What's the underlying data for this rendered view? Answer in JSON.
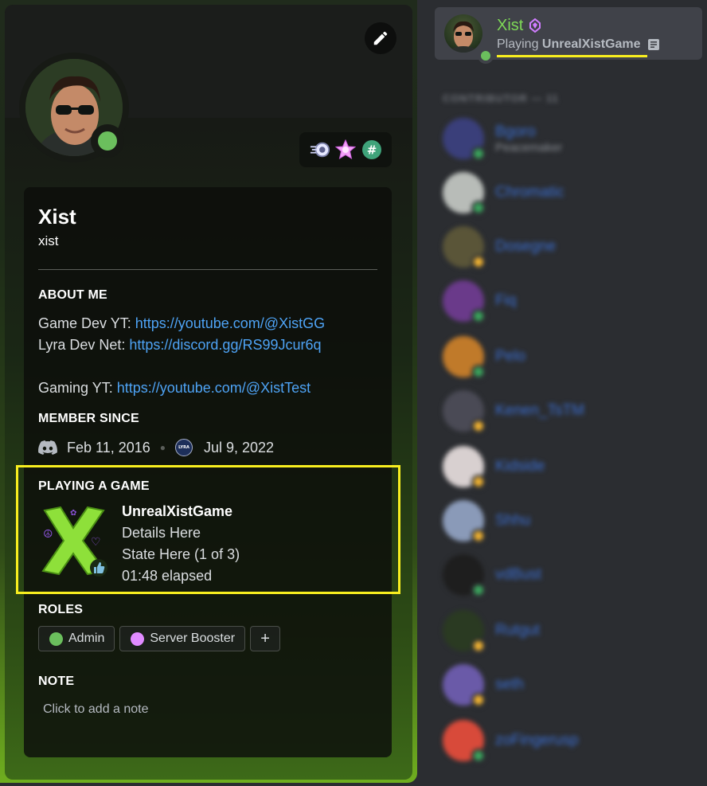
{
  "profile": {
    "display_name": "Xist",
    "username": "xist",
    "about_title": "ABOUT ME",
    "about_lines": {
      "game_dev_prefix": "Game Dev YT: ",
      "game_dev_link": "https://youtube.com/@XistGG",
      "lyra_prefix": "Lyra Dev Net: ",
      "lyra_link": "https://discord.gg/RS99Jcur6q",
      "gaming_prefix": "Gaming YT: ",
      "gaming_link": "https://youtube.com/@XistTest"
    },
    "member_since_title": "MEMBER SINCE",
    "discord_since": "Feb 11, 2016",
    "server_since": "Jul 9, 2022",
    "server_icon_label": "LYRA",
    "playing_title": "PLAYING A GAME",
    "game": {
      "name": "UnrealXistGame",
      "details": "Details Here",
      "state": "State Here (1 of 3)",
      "elapsed": "01:48 elapsed"
    },
    "roles_title": "ROLES",
    "roles": [
      {
        "label": "Admin",
        "color": "#6bbf5d"
      },
      {
        "label": "Server Booster",
        "color": "#e08bff"
      }
    ],
    "add_role_label": "+",
    "note_title": "NOTE",
    "note_placeholder": "Click to add a note",
    "status_color": "#6bbf5d"
  },
  "member_list": {
    "me": {
      "name": "Xist",
      "activity_prefix": "Playing ",
      "activity_game": "UnrealXistGame",
      "name_color": "#7ed957"
    },
    "group_header": "CONTRIBUTOR — 11",
    "members": [
      {
        "name": "Bgoro",
        "sub": "Peacemaker"
      },
      {
        "name": "Chromatic",
        "sub": ""
      },
      {
        "name": "Dosegne",
        "sub": ""
      },
      {
        "name": "Fiq",
        "sub": ""
      },
      {
        "name": "Pelo",
        "sub": ""
      },
      {
        "name": "Kenen_TsTM",
        "sub": ""
      },
      {
        "name": "Kidside",
        "sub": ""
      },
      {
        "name": "Shhu",
        "sub": ""
      },
      {
        "name": "vdBust",
        "sub": ""
      },
      {
        "name": "Rutgut",
        "sub": ""
      },
      {
        "name": "seth",
        "sub": ""
      },
      {
        "name": "zoFingerusp",
        "sub": ""
      }
    ]
  },
  "icons": {
    "edit": "pencil-icon",
    "discord": "discord-logo-icon",
    "badge_nitro": "nitro-badge-icon",
    "badge_booster": "star-booster-badge-icon",
    "badge_hash": "hashtag-badge-icon",
    "rich_presence": "rich-presence-icon",
    "boost_gem": "boost-gem-icon"
  }
}
